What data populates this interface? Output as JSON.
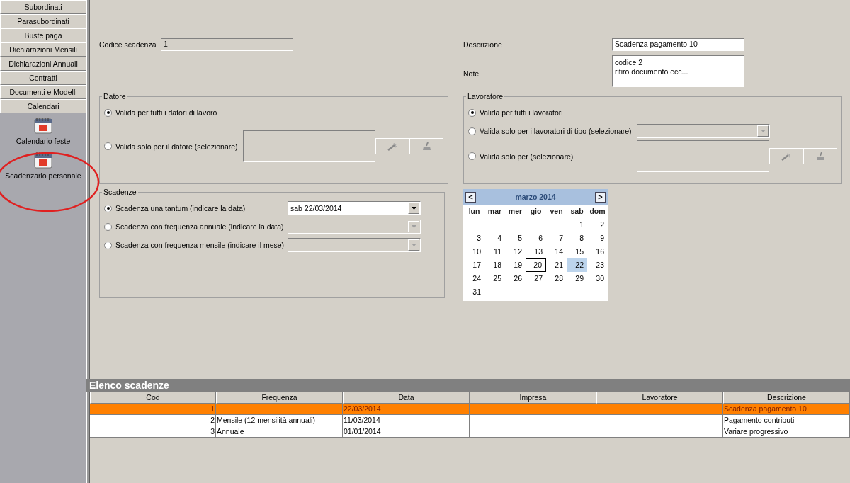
{
  "sidebar": {
    "menu": [
      {
        "label": "Subordinati"
      },
      {
        "label": "Parasubordinati"
      },
      {
        "label": "Buste paga"
      },
      {
        "label": "Dichiarazioni Mensili"
      },
      {
        "label": "Dichiarazioni Annuali"
      },
      {
        "label": "Contratti"
      },
      {
        "label": "Documenti e Modelli"
      },
      {
        "label": "Calendari"
      }
    ],
    "items": [
      {
        "label": "Calendario feste"
      },
      {
        "label": "Scadenzario personale"
      }
    ]
  },
  "form": {
    "codice": {
      "label": "Codice scadenza",
      "value": "1"
    },
    "descrizione": {
      "label": "Descrizione",
      "value": "Scadenza pagamento 10"
    },
    "note": {
      "label": "Note",
      "lines": [
        "codice 2",
        "ritiro documento ecc..."
      ]
    },
    "groups": [
      {
        "title": "Datore",
        "options": [
          {
            "label": "Valida per tutti i datori di lavoro",
            "selected": true,
            "kind": "plain"
          },
          {
            "label": "Valida solo per il datore (selezionare)",
            "selected": false,
            "kind": "picker"
          }
        ]
      },
      {
        "title": "Lavoratore",
        "options": [
          {
            "label": "Valida per tutti i lavoratori",
            "selected": true,
            "kind": "plain"
          },
          {
            "label": "Valida solo per i lavoratori di tipo (selezionare)",
            "selected": false,
            "kind": "combo",
            "disabled": true
          },
          {
            "label": "Valida solo per (selezionare)",
            "selected": false,
            "kind": "picker"
          }
        ]
      },
      {
        "title": "Scadenze",
        "options": [
          {
            "label": "Scadenza una tantum (indicare la data)",
            "selected": true,
            "kind": "combo",
            "disabled": false,
            "value": "sab 22/03/2014"
          },
          {
            "label": "Scadenza con frequenza annuale (indicare la data)",
            "selected": false,
            "kind": "combo",
            "disabled": true
          },
          {
            "label": "Scadenza con frequenza mensile (indicare il mese)",
            "selected": false,
            "kind": "combo",
            "disabled": true
          }
        ]
      }
    ]
  },
  "calendar": {
    "prev": "<",
    "next": ">",
    "month": "marzo 2014",
    "weekdays": [
      "lun",
      "mar",
      "mer",
      "gio",
      "ven",
      "sab",
      "dom"
    ],
    "weeks": [
      [
        {
          "day": "1",
          "selected": false,
          "today": false
        },
        {
          "day": "2",
          "selected": false,
          "today": false
        }
      ],
      [
        {
          "day": "3",
          "selected": false,
          "today": false
        },
        {
          "day": "4",
          "selected": false,
          "today": false
        },
        {
          "day": "5",
          "selected": false,
          "today": false
        },
        {
          "day": "6",
          "selected": false,
          "today": false
        },
        {
          "day": "7",
          "selected": false,
          "today": false
        },
        {
          "day": "8",
          "selected": false,
          "today": false
        },
        {
          "day": "9",
          "selected": false,
          "today": false
        }
      ],
      [
        {
          "day": "10",
          "selected": false,
          "today": false
        },
        {
          "day": "11",
          "selected": false,
          "today": false
        },
        {
          "day": "12",
          "selected": false,
          "today": false
        },
        {
          "day": "13",
          "selected": false,
          "today": false
        },
        {
          "day": "14",
          "selected": false,
          "today": false
        },
        {
          "day": "15",
          "selected": false,
          "today": false
        },
        {
          "day": "16",
          "selected": false,
          "today": false
        }
      ],
      [
        {
          "day": "17",
          "selected": false,
          "today": false
        },
        {
          "day": "18",
          "selected": false,
          "today": false
        },
        {
          "day": "19",
          "selected": false,
          "today": false
        },
        {
          "day": "20",
          "selected": false,
          "today": true
        },
        {
          "day": "21",
          "selected": false,
          "today": false
        },
        {
          "day": "22",
          "selected": true,
          "today": false
        },
        {
          "day": "23",
          "selected": false,
          "today": false
        }
      ],
      [
        {
          "day": "24",
          "selected": false,
          "today": false
        },
        {
          "day": "25",
          "selected": false,
          "today": false
        },
        {
          "day": "26",
          "selected": false,
          "today": false
        },
        {
          "day": "27",
          "selected": false,
          "today": false
        },
        {
          "day": "28",
          "selected": false,
          "today": false
        },
        {
          "day": "29",
          "selected": false,
          "today": false
        },
        {
          "day": "30",
          "selected": false,
          "today": false
        }
      ],
      [
        {
          "day": "31",
          "selected": false,
          "today": false
        }
      ]
    ]
  },
  "table": {
    "title": "Elenco scadenze",
    "columns": [
      "Cod",
      "Frequenza",
      "Data",
      "Impresa",
      "Lavoratore",
      "Descrizione"
    ],
    "rows": [
      {
        "selected": true,
        "cod": "1",
        "data": "22/03/2014",
        "descrizione": "Scadenza pagamento 10"
      },
      {
        "selected": false,
        "cod": "2",
        "frequenza": "Mensile (12 mensilità annuali)",
        "data": "11/03/2014",
        "descrizione": "Pagamento contributi"
      },
      {
        "selected": false,
        "cod": "3",
        "frequenza": "Annuale",
        "data": "01/01/2014",
        "descrizione": "Variare  progressivo"
      }
    ]
  }
}
